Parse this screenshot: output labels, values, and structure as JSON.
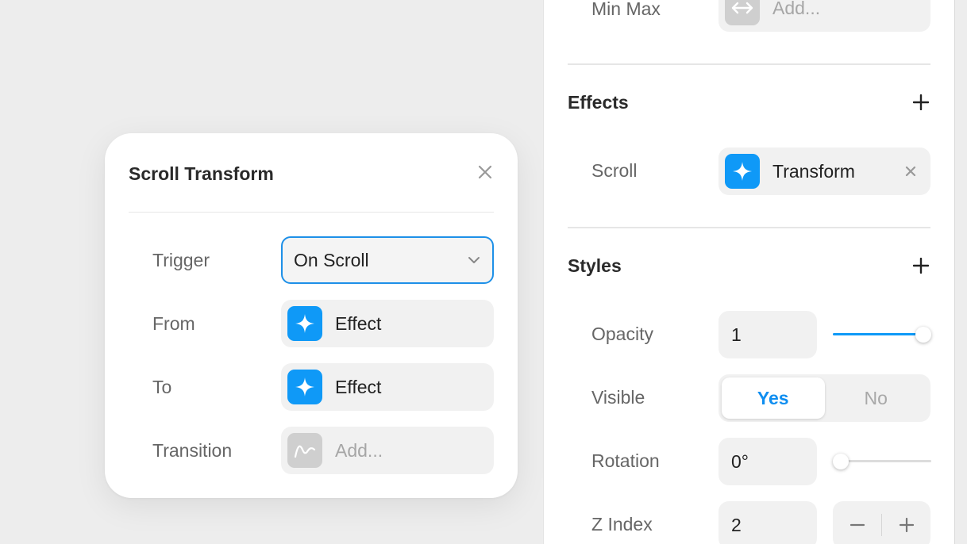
{
  "popover": {
    "title": "Scroll Transform",
    "rows": {
      "trigger": {
        "label": "Trigger",
        "value": "On Scroll"
      },
      "from": {
        "label": "From",
        "value": "Effect"
      },
      "to": {
        "label": "To",
        "value": "Effect"
      },
      "transition": {
        "label": "Transition",
        "placeholder": "Add..."
      }
    }
  },
  "panel": {
    "min_max": {
      "label": "Min Max",
      "placeholder": "Add..."
    },
    "effects": {
      "title": "Effects",
      "scroll": {
        "label": "Scroll",
        "value": "Transform"
      }
    },
    "styles": {
      "title": "Styles",
      "opacity": {
        "label": "Opacity",
        "value": "1",
        "level": 1.0
      },
      "visible": {
        "label": "Visible",
        "options": [
          "Yes",
          "No"
        ],
        "selected": "Yes"
      },
      "rotation": {
        "label": "Rotation",
        "value": "0°",
        "level": 0.0
      },
      "z_index": {
        "label": "Z Index",
        "value": "2"
      }
    }
  },
  "colors": {
    "accent": "#0f99f7",
    "focus_border": "#1e90e8"
  },
  "icons": [
    "close-icon",
    "chevron-down-icon",
    "sparkle-icon",
    "curve-icon",
    "resize-horizontal-icon",
    "plus-icon",
    "minus-icon"
  ]
}
